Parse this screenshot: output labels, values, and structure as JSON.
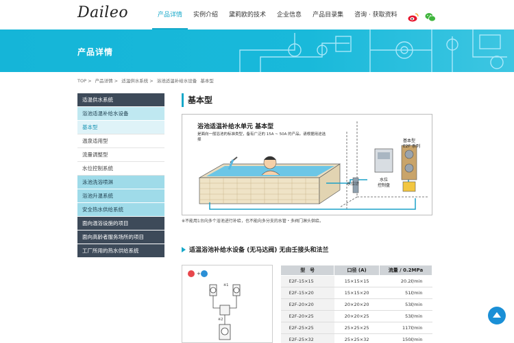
{
  "logo": "Daileo",
  "nav": [
    {
      "label": "产品详情",
      "active": true
    },
    {
      "label": "实例介绍",
      "active": false
    },
    {
      "label": "黛莉欧的技术",
      "active": false
    },
    {
      "label": "企业信息",
      "active": false
    },
    {
      "label": "产品目录集",
      "active": false
    },
    {
      "label": "咨询 · 获取资料",
      "active": false
    }
  ],
  "social": {
    "weibo": "weibo-icon",
    "wechat": "wechat-icon"
  },
  "banner": {
    "title": "产品详情"
  },
  "breadcrumb": [
    "TOP >",
    "产品详情 >",
    "适温供水系统 >",
    "浴池适温补给水设备",
    "基本型"
  ],
  "sidebar": [
    {
      "label": "适温供水系统",
      "style": "dark"
    },
    {
      "label": "浴池适温补给水设备",
      "style": "cyan"
    },
    {
      "label": "基本型",
      "style": "sub-active"
    },
    {
      "label": "温泉适用型",
      "style": "sub"
    },
    {
      "label": "流量调整型",
      "style": "sub"
    },
    {
      "label": "水位控制系统",
      "style": "sub"
    },
    {
      "label": "泳池洗浴喷淋",
      "style": "cyan"
    },
    {
      "label": "浴池升温系统",
      "style": "cyan"
    },
    {
      "label": "安全热水供给系统",
      "style": "cyan"
    },
    {
      "label": "面向温浴设施的项目",
      "style": "dark"
    },
    {
      "label": "面向高龄者服务场所的项目",
      "style": "dark"
    },
    {
      "label": "工厂所用的热水供给系统",
      "style": "dark"
    }
  ],
  "main": {
    "title": "基本型",
    "diagram": {
      "title": "浴池适温补给水单元 基本型",
      "desc": "是面向一般浴池的标准类型，备有广泛的 15A ~ 50A 的产品。请根据用途选择",
      "label_model": "基本型",
      "label_series": "E2F 系列",
      "label_sensor": "水位计",
      "label_control1": "水位",
      "label_control2": "控制盘"
    },
    "note": "※不能用1台向多个浴池进行补给，也不能向多分支的水管・多阀门淋头供给。",
    "subtitle": "适温浴池补给水设备 (无马达阀) 无由壬接头和法兰",
    "product_labels": {
      "mark1": "※1",
      "mark2": "※2"
    },
    "table": {
      "headers": [
        "型　号",
        "口径 (A)",
        "流量 / 0.2MPa"
      ],
      "rows": [
        [
          "E2F-15×15",
          "15×15×15",
          "20.2ℓ/min"
        ],
        [
          "E2F-15×20",
          "15×15×20",
          "51ℓ/min"
        ],
        [
          "E2F-20×20",
          "20×20×20",
          "53ℓ/min"
        ],
        [
          "E2F-20×25",
          "20×20×25",
          "53ℓ/min"
        ],
        [
          "E2F-25×25",
          "25×25×25",
          "117ℓ/min"
        ],
        [
          "E2F-25×32",
          "25×25×32",
          "150ℓ/min"
        ]
      ]
    }
  }
}
